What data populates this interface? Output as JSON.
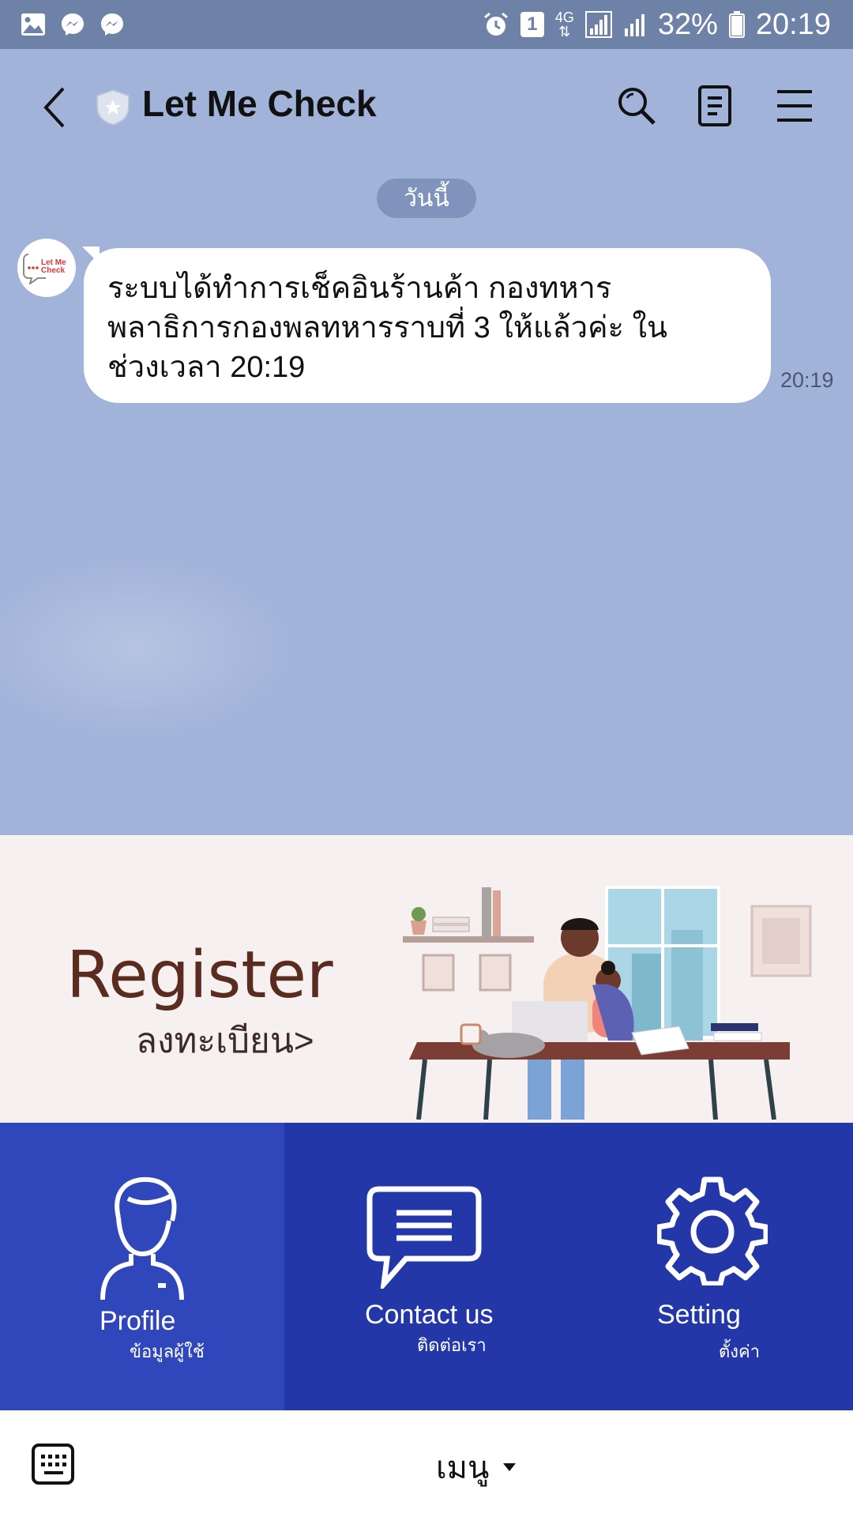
{
  "status_bar": {
    "sim_slot": "1",
    "network": "4G",
    "battery": "32%",
    "time": "20:19"
  },
  "header": {
    "title": "Let Me Check"
  },
  "chat": {
    "date_label": "วันนี้",
    "messages": [
      {
        "lines": [
          "ระบบได้ทำการเช็คอินร้านค้า กองทหาร",
          "พลาธิการกองพลทหารราบที่ 3 ให้แล้วค่ะ ใน",
          "ช่วงเวลา 20:19"
        ],
        "time": "20:19"
      }
    ]
  },
  "rich_menu": {
    "banner": {
      "title": "Register",
      "subtitle": "ลงทะเบียน>"
    },
    "items": [
      {
        "label": "Profile",
        "sub": "ข้อมูลผู้ใช้",
        "icon": "profile-icon"
      },
      {
        "label": "Contact us",
        "sub": "ติดต่อเรา",
        "icon": "chat-bubble-icon"
      },
      {
        "label": "Setting",
        "sub": "ตั้งค่า",
        "icon": "gear-icon"
      }
    ]
  },
  "bottom_bar": {
    "menu_label": "เมนู"
  },
  "colors": {
    "chat_background": "#a2b3da",
    "status_bar": "#6e82a8",
    "menu_blue_light": "#2f47bb",
    "menu_blue": "#2337a8",
    "register_text": "#5a2b1f"
  }
}
